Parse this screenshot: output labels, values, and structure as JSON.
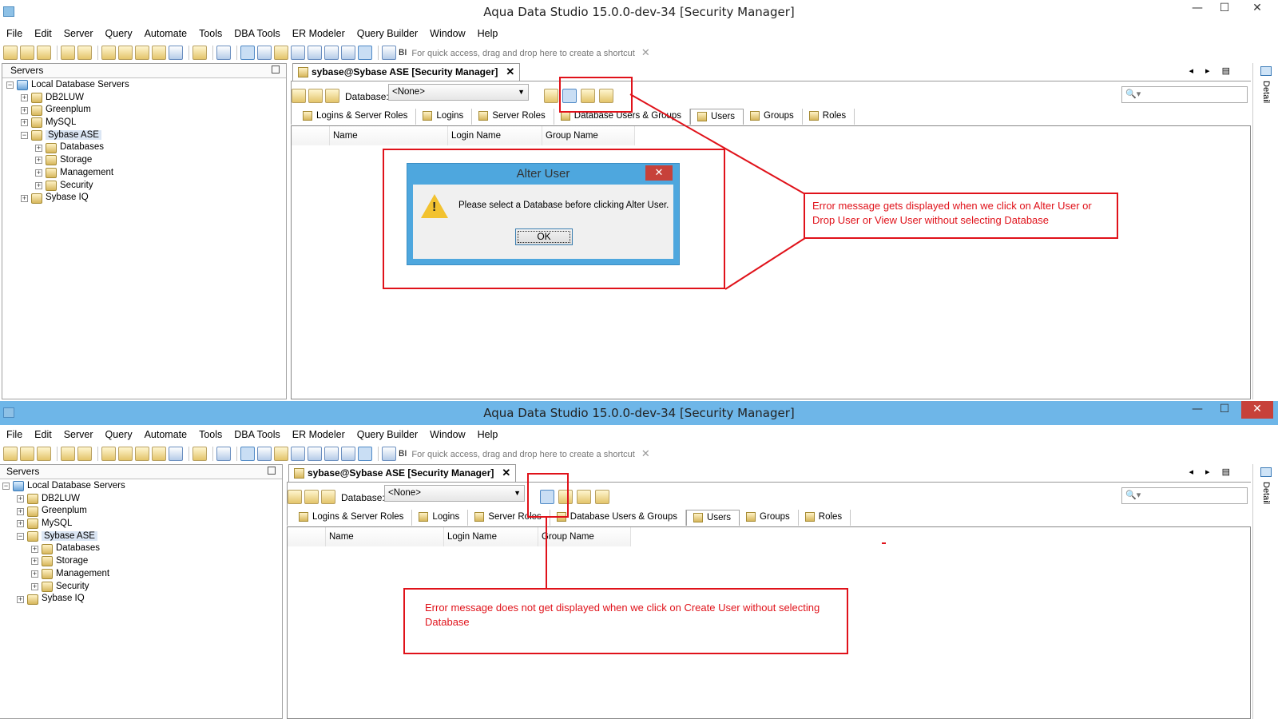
{
  "window": {
    "title": "Aqua Data Studio 15.0.0-dev-34 [Security Manager]",
    "min_glyph": "—",
    "max_glyph": "☐",
    "close_glyph": "✕"
  },
  "menu": [
    "File",
    "Edit",
    "Server",
    "Query",
    "Automate",
    "Tools",
    "DBA Tools",
    "ER Modeler",
    "Query Builder",
    "Window",
    "Help"
  ],
  "toolbar": {
    "bi_label": "BI",
    "quick_access": "For quick access, drag and drop here to create a shortcut",
    "quick_close": "✕"
  },
  "servers_panel": {
    "title": "Servers",
    "tree": [
      {
        "label": "Local Database Servers",
        "expander": "−"
      },
      {
        "label": "DB2LUW",
        "expander": "+"
      },
      {
        "label": "Greenplum",
        "expander": "+"
      },
      {
        "label": "MySQL",
        "expander": "+"
      },
      {
        "label": "Sybase ASE",
        "expander": "−",
        "selected": true
      },
      {
        "label": "Databases",
        "expander": "+"
      },
      {
        "label": "Storage",
        "expander": "+"
      },
      {
        "label": "Management",
        "expander": "+"
      },
      {
        "label": "Security",
        "expander": "+"
      },
      {
        "label": "Sybase IQ",
        "expander": "+"
      }
    ]
  },
  "editor": {
    "tab_label": "sybase@Sybase ASE [Security Manager]",
    "tab_close": "✕",
    "nav": "◂ ▸ ▤",
    "database_label": "Database:",
    "database_value": "<None>",
    "search_glyph": "🔍▾",
    "detail_label": "Detail",
    "tabs": [
      {
        "label": "Logins & Server Roles"
      },
      {
        "label": "Logins"
      },
      {
        "label": "Server Roles"
      },
      {
        "label": "Database Users & Groups"
      },
      {
        "label": "Users",
        "active": true
      },
      {
        "label": "Groups"
      },
      {
        "label": "Roles"
      }
    ],
    "columns": [
      "",
      "Name",
      "Login Name",
      "Group Name"
    ]
  },
  "dialog": {
    "title": "Alter User",
    "close_glyph": "✕",
    "warning_glyph": "!",
    "message": "Please select a Database before clicking Alter User.",
    "ok_label": "OK"
  },
  "annotations": {
    "top": "Error message gets displayed when we click on Alter User or Drop User or View User without selecting Database",
    "bottom": "Error message does not get displayed when we click on Create User without selecting Database"
  },
  "accent_colors": {
    "annotation": "#e0121a",
    "active_titlebar": "#6eb6e8",
    "dialog_frame": "#4ea7de"
  }
}
